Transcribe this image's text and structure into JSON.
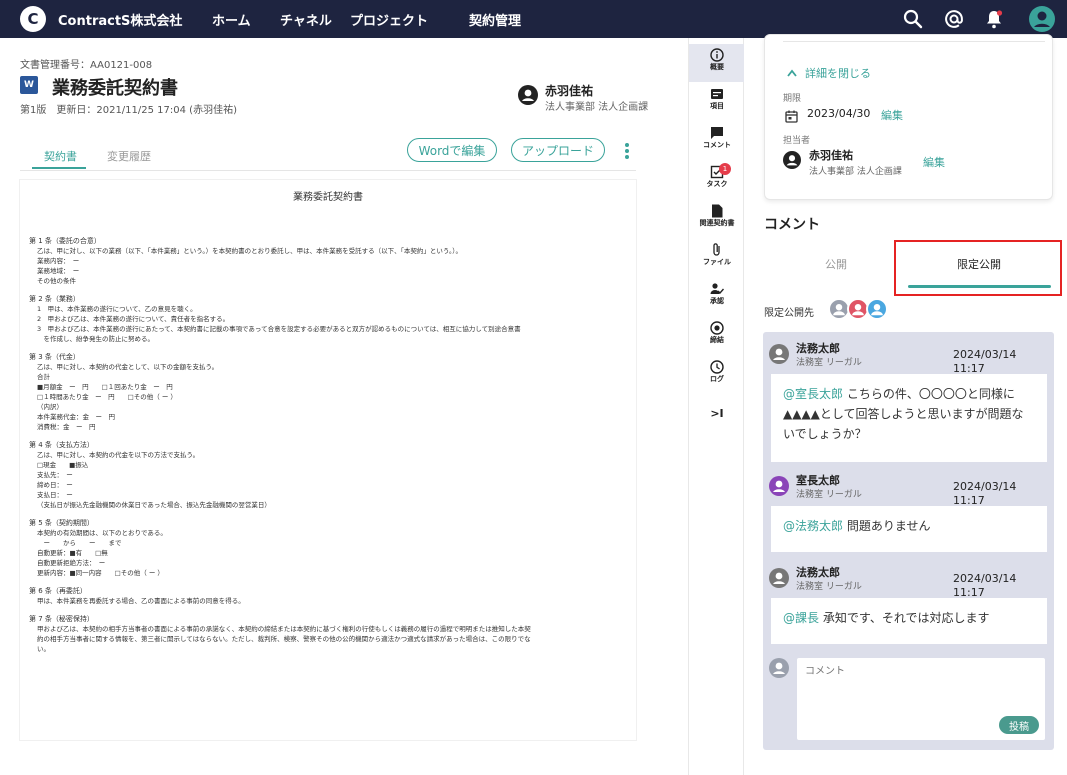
{
  "header": {
    "logo_letter": "C",
    "brand": "ContractS株式会社",
    "nav": [
      "ホーム",
      "チャネル",
      "プロジェクト",
      "契約管理"
    ],
    "icons": [
      "search-icon",
      "at-icon",
      "bell-icon",
      "avatar-icon"
    ],
    "bg_color": "#1e2440"
  },
  "document": {
    "doc_number": "文書管理番号：AA0121-008",
    "file_badge": "W",
    "title": "業務委託契約書",
    "meta": "第1版　更新日：2021/11/25 17:04 (赤羽佳祐)",
    "owner_name": "赤羽佳祐",
    "owner_dept": "法人事業部 法人企画課",
    "tabs": [
      "契約書",
      "変更履歴"
    ],
    "active_tab": "契約書",
    "buttons": {
      "edit_word": "Wordで編集",
      "upload": "アップロード"
    }
  },
  "paper": {
    "title": "業務委託契約書",
    "clauses": [
      {
        "heading": "第 1 条（委託の合意）",
        "lines": [
          "乙は、甲に対し、以下の業務（以下、「本件業務」という。）を本契約書のとおり委託し、甲は、本件業務を受託する（以下、「本契約」という。）。",
          "業務内容：　ー",
          "業務地域：　ー",
          "その他の条件"
        ]
      },
      {
        "heading": "第 2 条（業務）",
        "lines": [
          "1　甲は、本件業務の遂行について、乙の意見を聴く。",
          "2　甲および乙は、本件業務の遂行について、責任者を指名する。",
          "3　甲および乙は、本件業務の遂行にあたって、本契約書に記載の事項であって合意を設定する必要があると双方が認めるものについては、相互に協力して別途合意書",
          "　を作成し、紛争発生の防止に努める。"
        ]
      },
      {
        "heading": "第 3 条（代金）",
        "lines": [
          "乙は、甲に対し、本契約の代金として、以下の金額を支払う。",
          "合計",
          "■月額金　ー　円　　□１回あたり金　ー　円",
          "□１時間あたり金　ー　円　　□その他（ ー ）",
          "（内訳）",
          "本件業務代金：金　ー　円",
          "消費税：金　ー　円"
        ]
      },
      {
        "heading": "第 4 条（支払方法）",
        "lines": [
          "乙は、甲に対し、本契約の代金を以下の方法で支払う。",
          "□現金　　■振込",
          "支払先：　ー",
          "締め日：　ー",
          "支払日：　ー",
          "（支払日が振込先金融機関の休業日であった場合、振込先金融機関の翌営業日）"
        ]
      },
      {
        "heading": "第 5 条（契約期間）",
        "lines": [
          "本契約の有効期間は、以下のとおりである。",
          "　ー　　から　　ー　　まで",
          "自動更新：■有　　□無",
          "自動更新拒絶方法：　ー",
          "更新内容：■同一内容　　□その他（ ー ）"
        ]
      },
      {
        "heading": "第 6 条（再委託）",
        "lines": [
          "甲は、本件業務を再委託する場合、乙の書面による事前の同意を得る。"
        ]
      },
      {
        "heading": "第 7 条（秘密保持）",
        "lines": [
          "甲および乙は、本契約の相手方当事者の書面による事前の承諾なく、本契約の締結または本契約に基づく権利の行使もしくは義務の履行の過程で明明または推知した本契",
          "約の相手方当事者に関する情報を、第三者に開示してはならない。ただし、裁判所、検察、警察その他の公的機関から適法かつ適式な請求があった場合は、この限りでな",
          "い。"
        ]
      }
    ]
  },
  "side_nav": [
    {
      "label": "概要",
      "icon": "info-icon",
      "active": true
    },
    {
      "label": "項目",
      "icon": "list-icon",
      "active": false
    },
    {
      "label": "コメント",
      "icon": "comment-icon",
      "active": false
    },
    {
      "label": "タスク",
      "icon": "task-icon",
      "active": false,
      "badge": "1"
    },
    {
      "label": "関連契約書",
      "icon": "document-icon",
      "active": false
    },
    {
      "label": "ファイル",
      "icon": "paperclip-icon",
      "active": false
    },
    {
      "label": "承認",
      "icon": "approve-icon",
      "active": false
    },
    {
      "label": "締結",
      "icon": "seal-icon",
      "active": false
    },
    {
      "label": "ログ",
      "icon": "clock-icon",
      "active": false
    },
    {
      "label": ">I",
      "icon": "collapse-panel-icon",
      "active": false
    }
  ],
  "panel": {
    "collapse_label": "詳細を閉じる",
    "due_label": "期限",
    "due_date": "2023/04/30",
    "edit": "編集",
    "assignee_label": "担当者",
    "assignee_name": "赤羽佳祐",
    "assignee_dept": "法人事業部 法人企画課",
    "comment_heading": "コメント",
    "comment_tabs": [
      "公開",
      "限定公開"
    ],
    "active_comment_tab": "限定公開",
    "scope_label": "限定公開先",
    "scope_avatar_colors": [
      "#9aa0ad",
      "#e05566",
      "#4aa7e0"
    ],
    "accent_color": "#3aa39a",
    "highlight_color": "#e52323"
  },
  "comments": [
    {
      "name": "法務太郎",
      "dept": "法務室 リーガル",
      "time": "2024/03/14　11:17",
      "mention": "@室長太郎",
      "text": " こちらの件、〇〇〇〇と同様に▲▲▲▲として回答しようと思いますが問題ないでしょうか？",
      "avatar_color": "#777777"
    },
    {
      "name": "室長太郎",
      "dept": "法務室 リーガル",
      "time": "2024/03/14　11:17",
      "mention": "@法務太郎",
      "text": " 問題ありません",
      "avatar_color": "#8a44b8"
    },
    {
      "name": "法務太郎",
      "dept": "法務室 リーガル",
      "time": "2024/03/14　11:17",
      "mention": "@課長",
      "text": " 承知です、それでは対応します",
      "avatar_color": "#777777"
    }
  ],
  "comment_input": {
    "placeholder": "コメント",
    "post_label": "投稿"
  }
}
